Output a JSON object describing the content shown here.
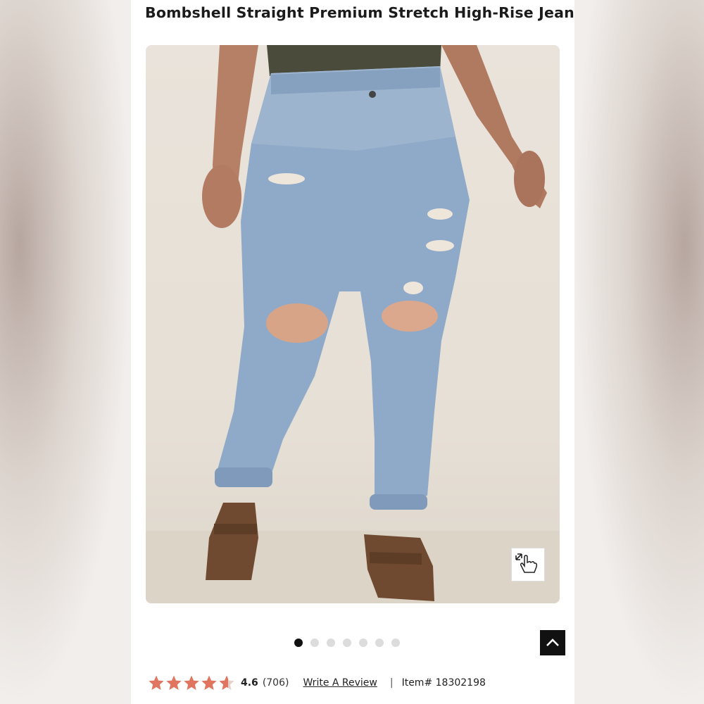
{
  "product": {
    "title": "Bombshell Straight Premium Stretch High-Rise Jean"
  },
  "gallery": {
    "slide_count": 7,
    "active_index": 0
  },
  "rating": {
    "score": "4.6",
    "count": "(706)",
    "value": 4.6,
    "max": 5,
    "star_color": "#e07560"
  },
  "review_link": "Write A Review",
  "separator": "|",
  "item_number": "Item# 18302198",
  "icons": {
    "zoom": "pinch-zoom-hand-icon",
    "scroll_top": "chevron-up-icon"
  }
}
